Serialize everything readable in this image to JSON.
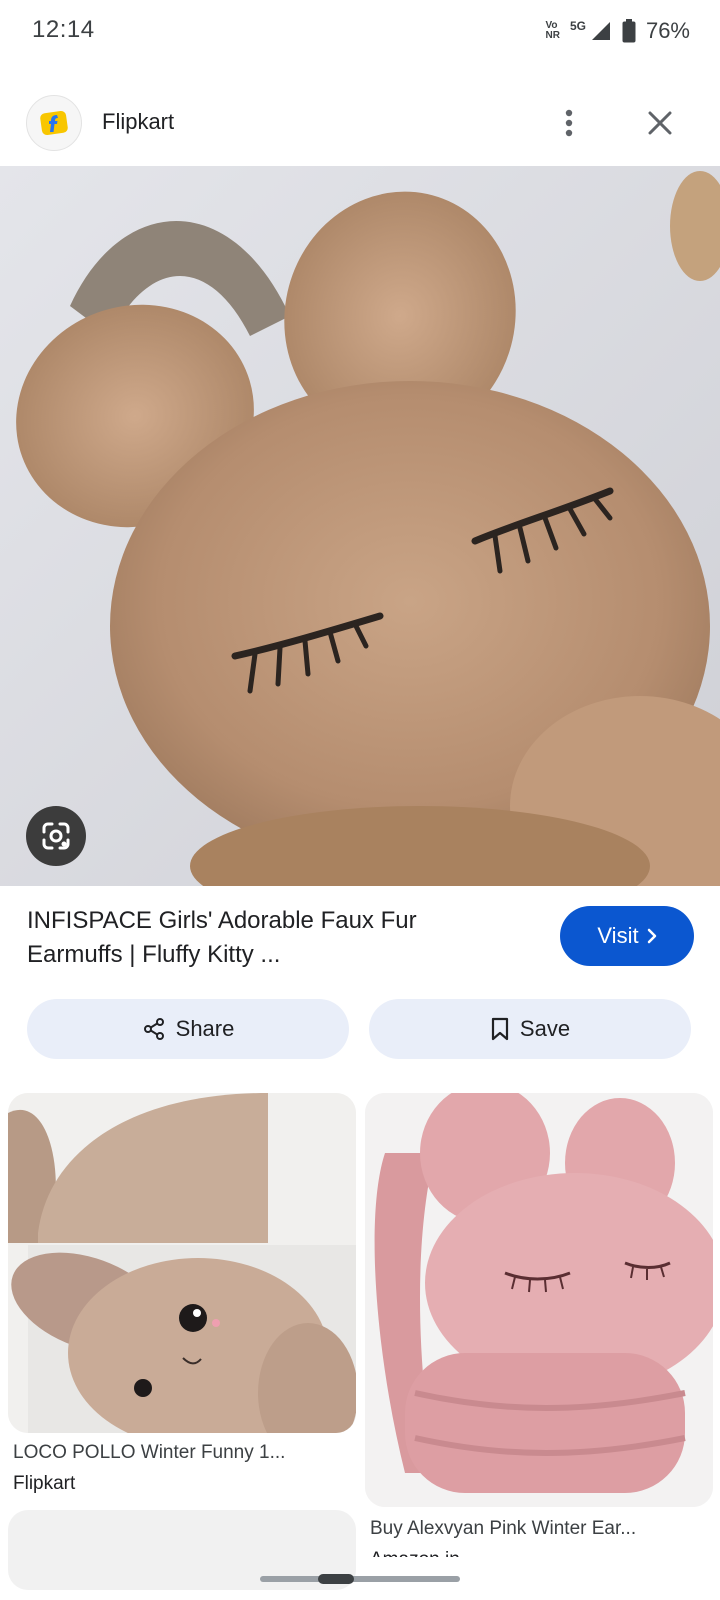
{
  "status_bar": {
    "time": "12:14",
    "net_top": "Vo",
    "net_bottom": "NR",
    "network": "5G",
    "battery": "76%"
  },
  "header": {
    "site_name": "Flipkart",
    "logo_icon": "flipkart-logo",
    "menu_icon": "more-vert-icon",
    "close_icon": "close-icon"
  },
  "product": {
    "title": "INFISPACE Girls' Adorable Faux Fur Earmuffs | Fluffy Kitty ...",
    "visit_label": "Visit",
    "share_label": "Share",
    "save_label": "Save"
  },
  "results": [
    {
      "title": "LOCO POLLO Winter Funny 1...",
      "source": "Flipkart"
    },
    {
      "title": "Buy Alexvyan Pink Winter Ear...",
      "source": "Amazon.in"
    }
  ],
  "colors": {
    "accent": "#0b57d0",
    "button_bg": "#e9eef9",
    "flipkart_yellow": "#f8c600",
    "flipkart_blue": "#2874f0"
  }
}
